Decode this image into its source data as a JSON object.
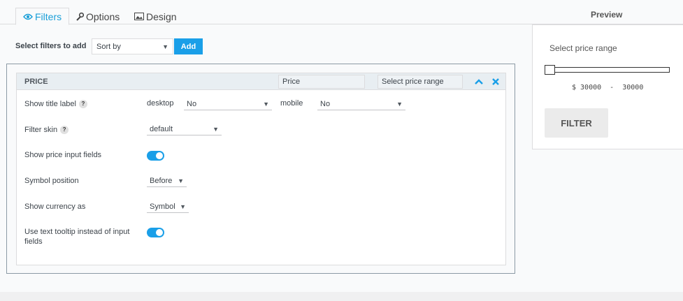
{
  "tabs": [
    {
      "label": "Filters",
      "icon": "eye-icon",
      "active": true
    },
    {
      "label": "Options",
      "icon": "wrench-icon",
      "active": false
    },
    {
      "label": "Design",
      "icon": "image-icon",
      "active": false
    }
  ],
  "preview": {
    "title": "Preview",
    "range_label": "Select price range",
    "range_text": "$ 30000  -  30000",
    "filter_button": "FILTER"
  },
  "select_filters": {
    "label": "Select filters to add",
    "dropdown_value": "Sort by",
    "add_button": "Add"
  },
  "price_panel": {
    "title": "PRICE",
    "title_input_value": "Price",
    "subtitle_input_value": "Select price range",
    "rows": {
      "show_title_label": {
        "label": "Show title label",
        "desktop_label": "desktop",
        "desktop_value": "No",
        "mobile_label": "mobile",
        "mobile_value": "No"
      },
      "filter_skin": {
        "label": "Filter skin",
        "value": "default"
      },
      "show_price_inputs": {
        "label": "Show price input fields",
        "on": true
      },
      "symbol_position": {
        "label": "Symbol position",
        "value": "Before"
      },
      "show_currency_as": {
        "label": "Show currency as",
        "value": "Symbol"
      },
      "text_tooltip": {
        "label": "Use text tooltip instead of input fields",
        "on": true
      }
    },
    "help_glyph": "?"
  },
  "colors": {
    "accent": "#1a9fe8",
    "tab_active_text": "#1a9fd8",
    "panel_header_bg": "#e8eef2"
  }
}
